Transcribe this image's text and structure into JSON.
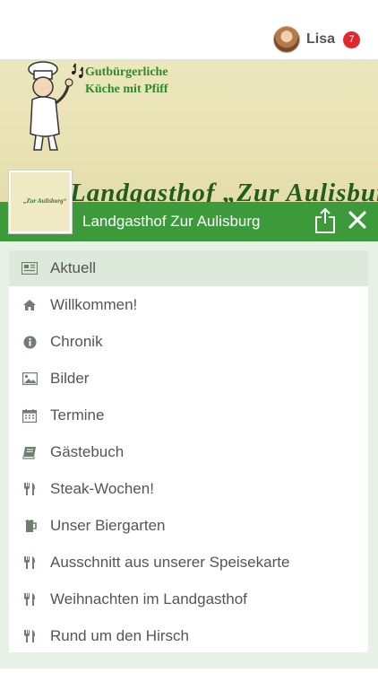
{
  "user": {
    "name": "Lisa",
    "notifications": "7"
  },
  "banner": {
    "slogan": "Gutbürgerliche\nKüche mit Pfiff",
    "name": "Landgasthof „Zur Aulisburg“",
    "logo_text": "„Zur Aulisburg“"
  },
  "header": {
    "title": "Landgasthof Zur Aulisburg"
  },
  "menu": {
    "items": [
      {
        "label": "Aktuell",
        "icon": "newspaper-icon",
        "active": true
      },
      {
        "label": "Willkommen!",
        "icon": "home-icon"
      },
      {
        "label": "Chronik",
        "icon": "info-icon"
      },
      {
        "label": "Bilder",
        "icon": "image-icon"
      },
      {
        "label": "Termine",
        "icon": "calendar-icon"
      },
      {
        "label": "Gästebuch",
        "icon": "book-icon"
      },
      {
        "label": "Steak-Wochen!",
        "icon": "fork-knife-icon"
      },
      {
        "label": "Unser Biergarten",
        "icon": "beer-icon"
      },
      {
        "label": "Ausschnitt aus unserer Speisekarte",
        "icon": "fork-knife-icon"
      },
      {
        "label": "Weihnachten im Landgasthof",
        "icon": "fork-knife-icon"
      },
      {
        "label": "Rund um den Hirsch",
        "icon": "fork-knife-icon"
      }
    ]
  },
  "colors": {
    "accent": "#3c9a3a",
    "badge": "#e2262b",
    "menu_bg": "#e8f1e6",
    "active_item": "#dde9da"
  }
}
